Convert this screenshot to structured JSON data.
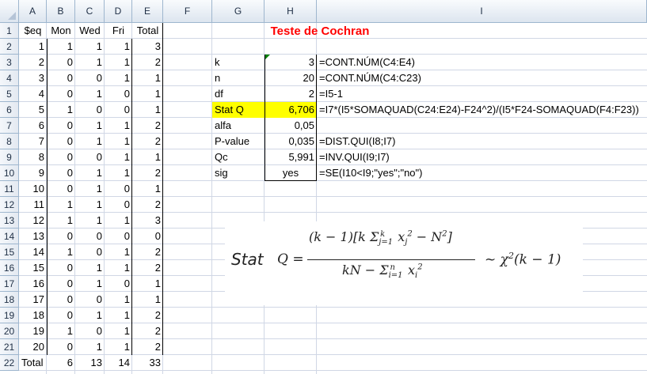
{
  "columns": [
    "A",
    "B",
    "C",
    "D",
    "E",
    "F",
    "G",
    "H",
    "I"
  ],
  "rows": [
    "1",
    "2",
    "3",
    "4",
    "5",
    "6",
    "7",
    "8",
    "9",
    "10",
    "11",
    "12",
    "13",
    "14",
    "15",
    "16",
    "17",
    "18",
    "19",
    "20",
    "21",
    "22"
  ],
  "table": {
    "headers": [
      "$eq",
      "Mon",
      "Wed",
      "Fri",
      "Total"
    ],
    "data": [
      [
        "1",
        "1",
        "1",
        "1",
        "3"
      ],
      [
        "2",
        "0",
        "1",
        "1",
        "2"
      ],
      [
        "3",
        "0",
        "0",
        "1",
        "1"
      ],
      [
        "4",
        "0",
        "1",
        "0",
        "1"
      ],
      [
        "5",
        "1",
        "0",
        "0",
        "1"
      ],
      [
        "6",
        "0",
        "1",
        "1",
        "2"
      ],
      [
        "7",
        "0",
        "1",
        "1",
        "2"
      ],
      [
        "8",
        "0",
        "0",
        "1",
        "1"
      ],
      [
        "9",
        "0",
        "1",
        "1",
        "2"
      ],
      [
        "10",
        "0",
        "1",
        "0",
        "1"
      ],
      [
        "11",
        "1",
        "1",
        "0",
        "2"
      ],
      [
        "12",
        "1",
        "1",
        "1",
        "3"
      ],
      [
        "13",
        "0",
        "0",
        "0",
        "0"
      ],
      [
        "14",
        "1",
        "0",
        "1",
        "2"
      ],
      [
        "15",
        "0",
        "1",
        "1",
        "2"
      ],
      [
        "16",
        "0",
        "1",
        "0",
        "1"
      ],
      [
        "17",
        "0",
        "0",
        "1",
        "1"
      ],
      [
        "18",
        "0",
        "1",
        "1",
        "2"
      ],
      [
        "19",
        "1",
        "0",
        "1",
        "2"
      ],
      [
        "20",
        "0",
        "1",
        "1",
        "2"
      ]
    ],
    "totals": [
      "Total",
      "6",
      "13",
      "14",
      "33"
    ]
  },
  "stats": {
    "title": "Teste de Cochran",
    "rows": [
      {
        "label": "k",
        "value": "3",
        "formula": "=CONT.NÚM(C4:E4)"
      },
      {
        "label": "n",
        "value": "20",
        "formula": "=CONT.NÚM(C4:C23)"
      },
      {
        "label": "df",
        "value": "2",
        "formula": "=I5-1"
      },
      {
        "label": "Stat Q",
        "value": "6,706",
        "formula": "=I7*(I5*SOMAQUAD(C24:E24)-F24^2)/(I5*F24-SOMAQUAD(F4:F23))"
      },
      {
        "label": "alfa",
        "value": "0,05",
        "formula": ""
      },
      {
        "label": "P-value",
        "value": "0,035",
        "formula": "=DIST.QUI(I8;I7)"
      },
      {
        "label": "Qc",
        "value": "5,991",
        "formula": "=INV.QUI(I9;I7)"
      },
      {
        "label": "sig",
        "value": "yes",
        "formula": "=SE(I10<I9;\"yes\";\"no\")"
      }
    ]
  },
  "formula_image": {
    "stat_label": "Stat",
    "lhs": "Q =",
    "numerator": "(k − 1)[k Σ",
    "num_sub": "j=1",
    "num_sup": "k",
    "num_rest": "x",
    "num_x_sub": "j",
    "num_x_sup": "2",
    "num_end": " − N",
    "num_end_sup": "2",
    "num_close": "]",
    "denominator": "kN − Σ",
    "den_sub": "i=1",
    "den_sup": "n",
    "den_rest": "x",
    "den_x_sub": "i",
    "den_x_sup": "2",
    "rhs": "~ χ",
    "rhs_sup": "2",
    "rhs_end": "(k − 1)"
  },
  "colors": {
    "title": "#ff0000",
    "highlight": "#ffff00",
    "grid": "#d0d7e5",
    "header": "#dde5ef"
  }
}
